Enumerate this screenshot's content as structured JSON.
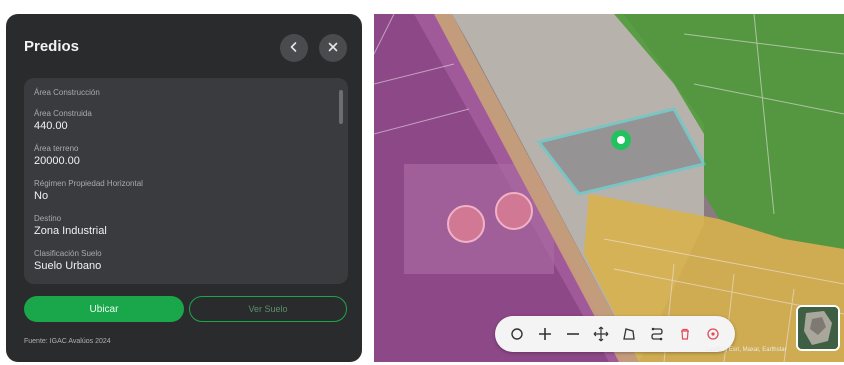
{
  "panel": {
    "title": "Predios",
    "fields": [
      {
        "label": "Área Construcción",
        "value": ""
      },
      {
        "label": "Área Construida",
        "value": "440.00"
      },
      {
        "label": "Área terreno",
        "value": "20000.00"
      },
      {
        "label": "Régimen Propiedad Horizontal",
        "value": "No"
      },
      {
        "label": "Destino",
        "value": "Zona Industrial"
      },
      {
        "label": "Clasificación Suelo",
        "value": "Suelo Urbano"
      }
    ],
    "primary_button": "Ubicar",
    "secondary_button": "Ver Suelo",
    "footer_note": "Fuente: IGAC Avalúos 2024"
  },
  "icons": {
    "back": "chevron-left-icon",
    "close": "close-icon",
    "toolbar": [
      "circle-icon",
      "zoom-in-icon",
      "zoom-out-icon",
      "move-icon",
      "polygon-icon",
      "route-icon",
      "trash-icon",
      "target-icon"
    ]
  },
  "map": {
    "attribution": "Leaflet | Esri, Maxar, Earthstar"
  },
  "colors": {
    "panel_bg": "#2a2b2d",
    "card_bg": "#3a3b3e",
    "accent_green": "#1aa64a",
    "zone_purple": "#9a3f8f",
    "zone_yellow": "#d8b24a",
    "zone_green": "#4f9a3a",
    "selection_cyan": "#49d6d6",
    "marker_green": "#22c35e"
  }
}
